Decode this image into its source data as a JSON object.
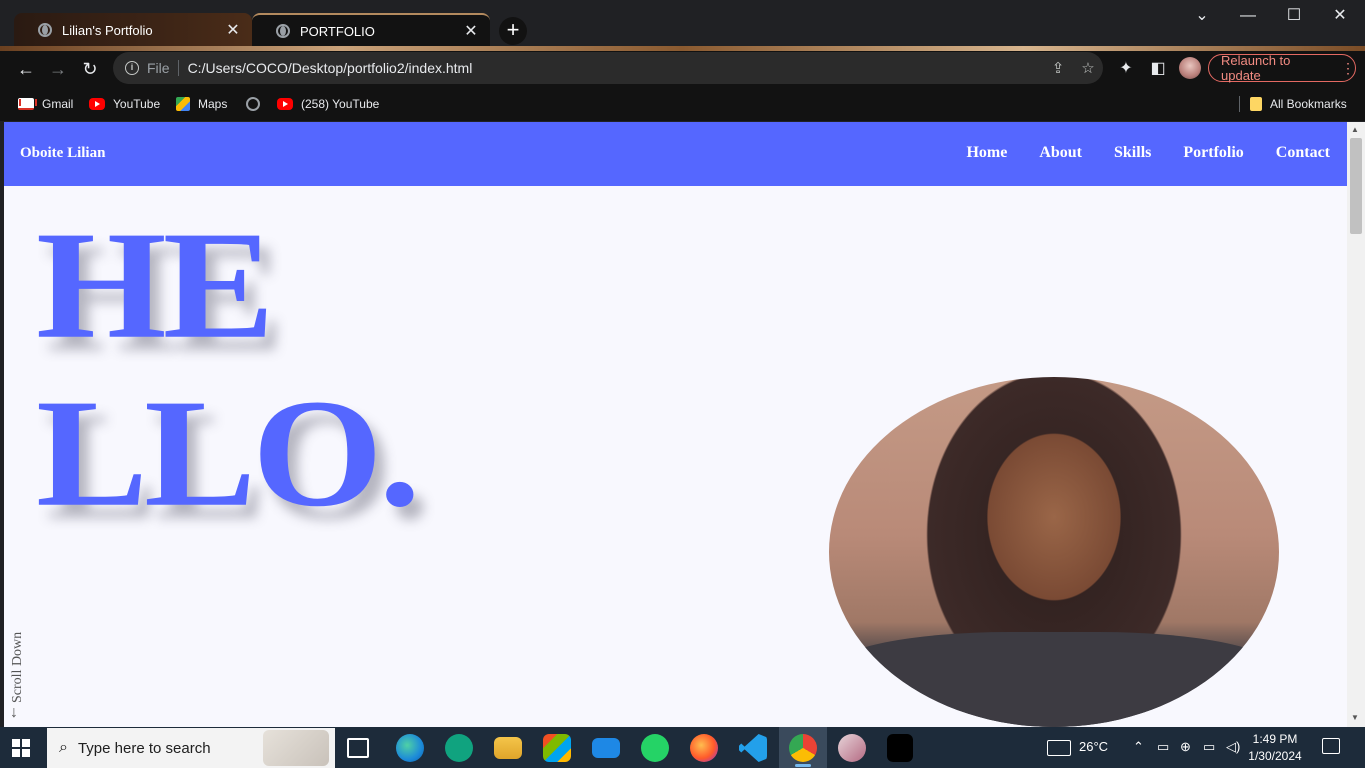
{
  "browser": {
    "tabs": [
      {
        "title": "Lilian's Portfolio",
        "active": false
      },
      {
        "title": "PORTFOLIO",
        "active": true
      }
    ],
    "address": {
      "scheme_label": "File",
      "url": "C:/Users/COCO/Desktop/portfolio2/index.html"
    },
    "relaunch_label": "Relaunch to update",
    "bookmarks": [
      {
        "label": "Gmail",
        "icon": "gmail-icon"
      },
      {
        "label": "YouTube",
        "icon": "youtube-icon"
      },
      {
        "label": "Maps",
        "icon": "maps-icon"
      },
      {
        "label": "",
        "icon": "globe-icon"
      },
      {
        "label": "(258) YouTube",
        "icon": "youtube-icon"
      }
    ],
    "all_bookmarks_label": "All Bookmarks"
  },
  "site": {
    "brand": "Oboite Lilian",
    "menu": [
      "Home",
      "About",
      "Skills",
      "Portfolio",
      "Contact"
    ],
    "hero_line1": "HE",
    "hero_line2": "LLO.",
    "scroll_label": "Scroll Down",
    "accent_color": "#5567ff"
  },
  "taskbar": {
    "search_placeholder": "Type here to search",
    "weather": "26°C",
    "time": "1:49 PM",
    "date": "1/30/2024"
  }
}
